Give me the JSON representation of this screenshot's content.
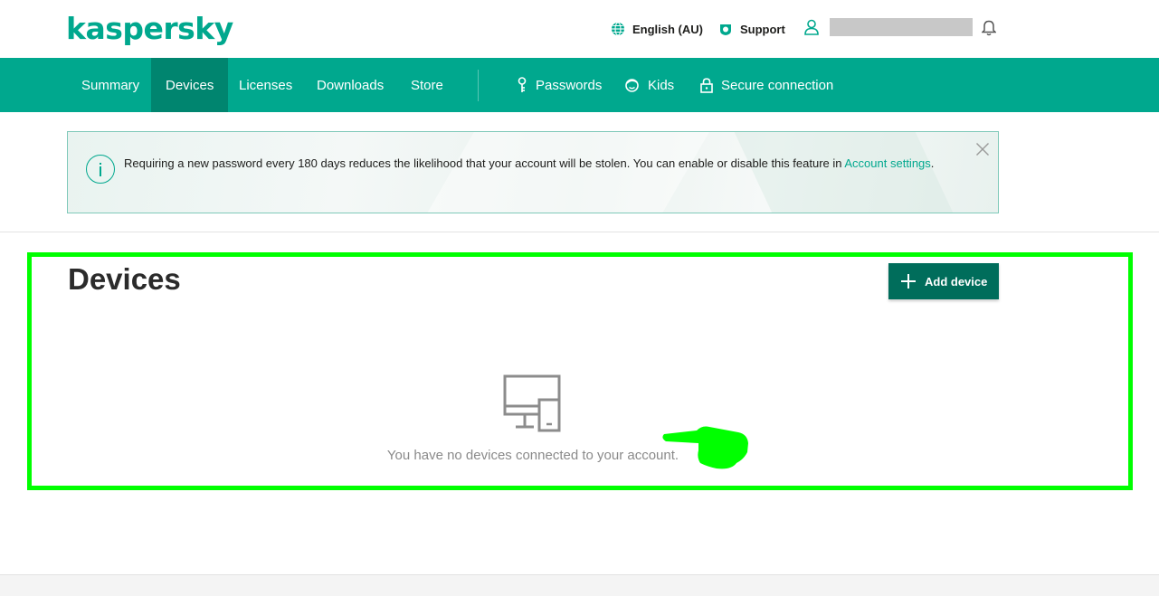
{
  "header": {
    "logo": "kaspersky",
    "language": "English (AU)",
    "support": "Support"
  },
  "nav": {
    "items": [
      {
        "label": "Summary"
      },
      {
        "label": "Devices",
        "active": true
      },
      {
        "label": "Licenses"
      },
      {
        "label": "Downloads"
      },
      {
        "label": "Store"
      },
      {
        "label": "Passwords",
        "icon": "key-icon"
      },
      {
        "label": "Kids",
        "icon": "kids-icon"
      },
      {
        "label": "Secure connection",
        "icon": "lock-icon"
      }
    ]
  },
  "notice": {
    "text": "Requiring a new password every 180 days reduces the likelihood that your account will be stolen. You can enable or disable this feature in ",
    "link": "Account settings",
    "suffix": "."
  },
  "main": {
    "title": "Devices",
    "add_button": "Add device",
    "empty_message": "You have no devices connected to your account."
  },
  "colors": {
    "brand": "#00a88e",
    "nav_active": "#00856f",
    "button": "#006d5b",
    "highlight": "#00ff00"
  }
}
